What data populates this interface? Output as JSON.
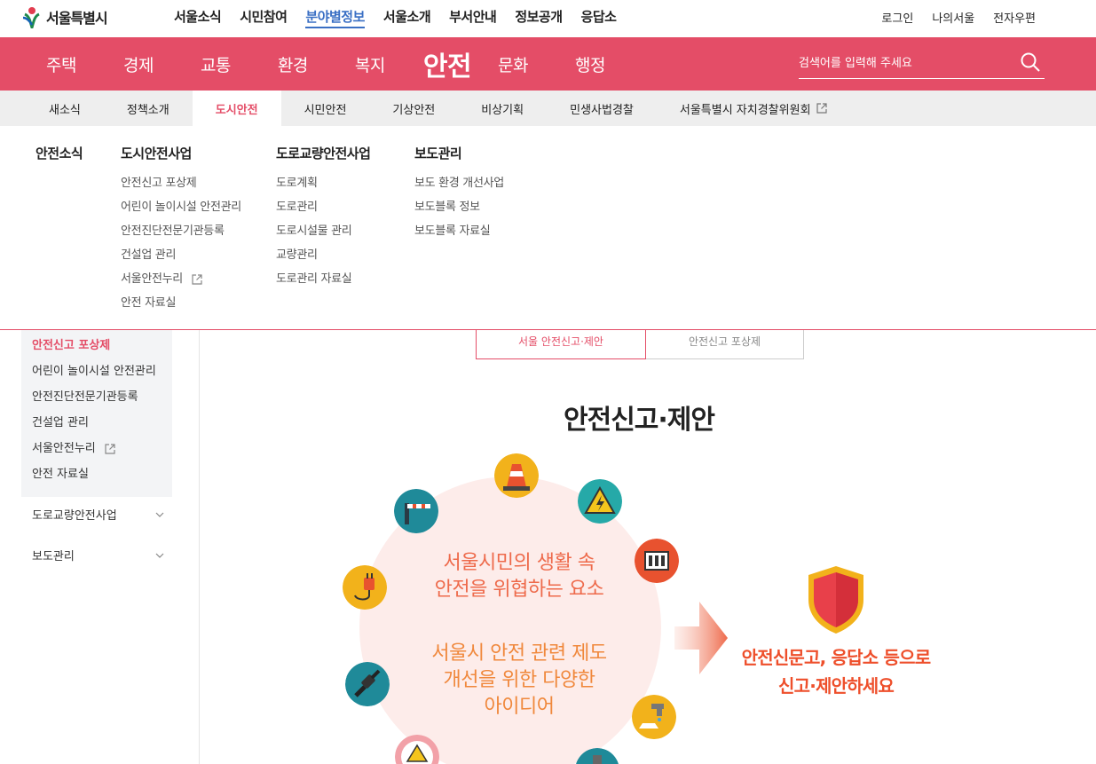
{
  "logo": {
    "text": "서울특별시"
  },
  "gnb": {
    "items": [
      {
        "label": "서울소식"
      },
      {
        "label": "시민참여"
      },
      {
        "label": "분야별정보",
        "active": true
      },
      {
        "label": "서울소개"
      },
      {
        "label": "부서안내"
      },
      {
        "label": "정보공개"
      },
      {
        "label": "응답소"
      }
    ]
  },
  "util": {
    "items": [
      {
        "label": "로그인"
      },
      {
        "label": "나의서울"
      },
      {
        "label": "전자우편"
      }
    ]
  },
  "mainnav": {
    "items": [
      {
        "label": "주택"
      },
      {
        "label": "경제"
      },
      {
        "label": "교통"
      },
      {
        "label": "환경"
      },
      {
        "label": "복지"
      },
      {
        "label": "안전",
        "current": true
      },
      {
        "label": "문화"
      },
      {
        "label": "행정"
      }
    ],
    "search_placeholder": "검색어를 입력해 주세요",
    "accent_color": "#e44d67"
  },
  "subnav": {
    "items": [
      {
        "label": "새소식"
      },
      {
        "label": "정책소개"
      },
      {
        "label": "도시안전",
        "active": true
      },
      {
        "label": "시민안전"
      },
      {
        "label": "기상안전"
      },
      {
        "label": "비상기획"
      },
      {
        "label": "민생사법경찰"
      },
      {
        "label": "서울특별시 자치경찰위원회",
        "external": true
      }
    ]
  },
  "mega": {
    "col1": {
      "title": "안전소식",
      "items": []
    },
    "col2": {
      "title": "도시안전사업",
      "items": [
        "안전신고 포상제",
        "어린이 놀이시설 안전관리",
        "안전진단전문기관등록",
        "건설업 관리",
        "서울안전누리",
        "안전 자료실"
      ]
    },
    "col3": {
      "title": "도로교량안전사업",
      "items": [
        "도로계획",
        "도로관리",
        "도로시설물 관리",
        "교량관리",
        "도로관리 자료실"
      ]
    },
    "col4": {
      "title": "보도관리",
      "items": [
        "보도 환경 개선사업",
        "보도블록 정보",
        "보도블록 자료실"
      ]
    }
  },
  "sidebar": {
    "items": [
      {
        "label": "안전신고 포상제",
        "active": true
      },
      {
        "label": "어린이 놀이시설 안전관리"
      },
      {
        "label": "안전진단전문기관등록"
      },
      {
        "label": "건설업 관리"
      },
      {
        "label": "서울안전누리"
      },
      {
        "label": "안전 자료실"
      }
    ],
    "groups": [
      {
        "label": "도로교량안전사업"
      },
      {
        "label": "보도관리"
      }
    ]
  },
  "tabs": [
    {
      "label": "서울 안전신고·제안",
      "active": true
    },
    {
      "label": "안전신고 포상제"
    }
  ],
  "content": {
    "title": "안전신고·제안",
    "circle_line1": "서울시민의 생활 속",
    "circle_line2": "안전을 위협하는 요소",
    "circle_line3": "서울시 안전 관련 제도",
    "circle_line4": "개선을 위한 다양한",
    "circle_line5": "아이디어",
    "cta_line1": "안전신문고, 응답소 등으로",
    "cta_line2": "신고·제안하세요"
  }
}
